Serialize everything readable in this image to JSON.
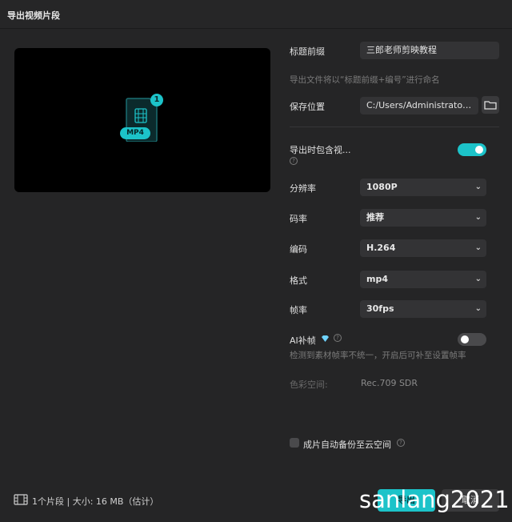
{
  "window": {
    "title": "导出视频片段"
  },
  "preview": {
    "badge_count": "1",
    "format_tag": "MP4"
  },
  "form": {
    "title_prefix": {
      "label": "标题前缀",
      "value": "三郎老师剪映教程"
    },
    "naming_hint": "导出文件将以“标题前缀+编号”进行命名",
    "save_location": {
      "label": "保存位置",
      "value": "C:/Users/Administrator/..."
    },
    "include_video": {
      "label": "导出时包含视...",
      "on": true
    },
    "resolution": {
      "label": "分辨率",
      "value": "1080P"
    },
    "bitrate": {
      "label": "码率",
      "value": "推荐"
    },
    "codec": {
      "label": "编码",
      "value": "H.264"
    },
    "format": {
      "label": "格式",
      "value": "mp4"
    },
    "framerate": {
      "label": "帧率",
      "value": "30fps"
    },
    "ai_frame": {
      "label": "AI补帧",
      "on": false,
      "hint": "检测到素材帧率不统一，开启后可补至设置帧率"
    },
    "color_space": {
      "label": "色彩空间:",
      "value": "Rec.709 SDR"
    },
    "cloud_backup": {
      "label": "成片自动备份至云空间",
      "checked": false
    }
  },
  "footer": {
    "summary": "1个片段 | 大小: 16 MB（估计）",
    "export_label": "导出",
    "cancel_label": "取消"
  },
  "watermark": "sanlang2021",
  "colors": {
    "accent": "#1cc3c9",
    "background": "#252526",
    "field": "#333335"
  }
}
